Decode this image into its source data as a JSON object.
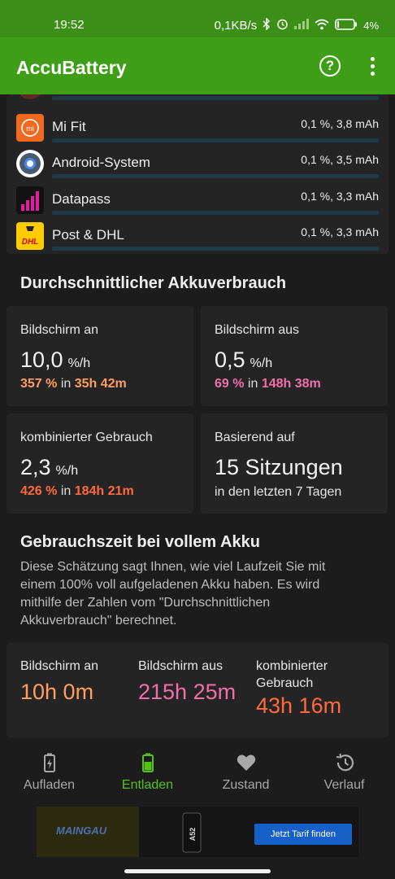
{
  "status_bar": {
    "time": "19:52",
    "speed": "0,1KB/s",
    "battery": "4"
  },
  "app_bar": {
    "title": "AccuBattery"
  },
  "apps": [
    {
      "name": "Mi Fit",
      "value": "0,1 %, 3,8 mAh"
    },
    {
      "name": "Android-System",
      "value": "0,1 %, 3,5 mAh"
    },
    {
      "name": "Datapass",
      "value": "0,1 %, 3,3 mAh"
    },
    {
      "name": "Post & DHL",
      "value": "0,1 %, 3,3 mAh"
    }
  ],
  "avg_usage": {
    "title": "Durchschnittlicher Akkuverbrauch",
    "screen_on": {
      "label": "Bildschirm an",
      "value": "10,0",
      "unit": "%/h",
      "percent": "357 %",
      "in": "in",
      "duration": "35h 42m",
      "color": "#ff9e5e"
    },
    "screen_off": {
      "label": "Bildschirm aus",
      "value": "0,5",
      "unit": "%/h",
      "percent": "69 %",
      "in": "in",
      "duration": "148h 38m",
      "color": "#f06fa8"
    },
    "combined": {
      "label": "kombinierter Gebrauch",
      "value": "2,3",
      "unit": "%/h",
      "percent": "426 %",
      "in": "in",
      "duration": "184h 21m",
      "color": "#ff6a3c"
    },
    "based_on": {
      "label": "Basierend auf",
      "value": "15 Sitzungen",
      "sub": "in den letzten 7 Tagen"
    }
  },
  "full_battery": {
    "title": "Gebrauchszeit bei vollem Akku",
    "description": "Diese Schätzung sagt Ihnen, wie viel Laufzeit Sie mit einem 100% voll aufgeladenen Akku haben. Es wird mithilfe der Zahlen vom \"Durchschnittlichen Akkuverbrauch\" berechnet.",
    "screen_on": {
      "label": "Bildschirm an",
      "value": "10h 0m",
      "color": "#ff9e5e"
    },
    "screen_off": {
      "label": "Bildschirm aus",
      "value": "215h 25m",
      "color": "#f06fa8"
    },
    "combined": {
      "label_line1": "kombinierter",
      "label_line2": "Gebrauch",
      "value": "43h 16m",
      "color": "#ff6a3c"
    }
  },
  "bottom_nav": [
    {
      "label": "Aufladen",
      "icon": "battery-charging-icon",
      "active": false
    },
    {
      "label": "Entladen",
      "icon": "battery-icon",
      "active": true
    },
    {
      "label": "Zustand",
      "icon": "heart-icon",
      "active": false
    },
    {
      "label": "Verlauf",
      "icon": "history-icon",
      "active": false
    }
  ],
  "ad": {
    "brand": "MAINGAU",
    "phone_label": "A52",
    "button": "Jetzt Tarif finden"
  },
  "colors": {
    "status_green": "#3b8f16",
    "appbar_green": "#3f9e18",
    "active_green": "#55c21c",
    "background": "#1c1c1c",
    "card": "#242424"
  }
}
